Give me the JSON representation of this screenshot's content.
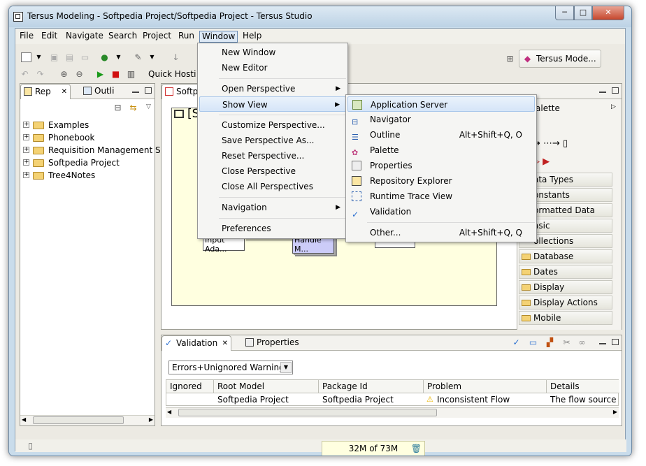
{
  "window": {
    "title": "Tersus Modeling - Softpedia Project/Softpedia Project - Tersus Studio",
    "min_label": "─",
    "max_label": "□",
    "close_label": "✕"
  },
  "menubar": [
    "File",
    "Edit",
    "Navigate",
    "Search",
    "Project",
    "Run",
    "Window",
    "Help"
  ],
  "toolbar": {
    "quick_label": "Quick Hosti",
    "perspective_label": "Tersus Mode..."
  },
  "left_panel": {
    "tabs": [
      "Rep",
      "Outli"
    ],
    "tree": [
      "Examples",
      "Phonebook",
      "Requisition Management Syst",
      "Softpedia Project",
      "Tree4Notes"
    ]
  },
  "editor": {
    "tab_label": "Softpe",
    "model_title": "[S",
    "nodes": [
      "Input Ada...",
      "Handle M..."
    ]
  },
  "palette": {
    "title": "alette",
    "items": [
      "ata Types",
      "onstants",
      "ormatted Data Ty...",
      "asic",
      "ollections",
      "Database",
      "Dates",
      "Display",
      "Display Actions",
      "Mobile"
    ]
  },
  "window_menu": {
    "items": [
      {
        "label": "New Window",
        "submenu": false
      },
      {
        "label": "New Editor",
        "submenu": false
      },
      {
        "label": "Open Perspective",
        "submenu": true
      },
      {
        "label": "Show View",
        "submenu": true
      },
      {
        "label": "Customize Perspective...",
        "submenu": false
      },
      {
        "label": "Save Perspective As...",
        "submenu": false
      },
      {
        "label": "Reset Perspective...",
        "submenu": false
      },
      {
        "label": "Close Perspective",
        "submenu": false
      },
      {
        "label": "Close All Perspectives",
        "submenu": false
      },
      {
        "label": "Navigation",
        "submenu": true
      },
      {
        "label": "Preferences",
        "submenu": false
      }
    ]
  },
  "show_view_menu": {
    "items": [
      {
        "label": "Application Server",
        "accel": ""
      },
      {
        "label": "Navigator",
        "accel": ""
      },
      {
        "label": "Outline",
        "accel": "Alt+Shift+Q, O"
      },
      {
        "label": "Palette",
        "accel": ""
      },
      {
        "label": "Properties",
        "accel": ""
      },
      {
        "label": "Repository Explorer",
        "accel": ""
      },
      {
        "label": "Runtime Trace View",
        "accel": ""
      },
      {
        "label": "Validation",
        "accel": ""
      },
      {
        "label": "Other...",
        "accel": "Alt+Shift+Q, Q"
      }
    ]
  },
  "bottom_panel": {
    "tabs": [
      "Validation",
      "Properties"
    ],
    "filter_value": "Errors+Unignored Warnings",
    "columns": [
      "Ignored",
      "Root Model",
      "Package Id",
      "Problem",
      "Details"
    ],
    "rows": [
      {
        "ignored": "",
        "root_model": "Softpedia Project",
        "package_id": "Softpedia Project",
        "problem": "Inconsistent Flow",
        "details": "The flow source is"
      }
    ]
  },
  "status": {
    "memory": "32M of 73M"
  },
  "colors": {
    "menu_highlight": "#d5e5f8",
    "canvas_bg": "#ffffe0",
    "warning": "#e8b400"
  }
}
